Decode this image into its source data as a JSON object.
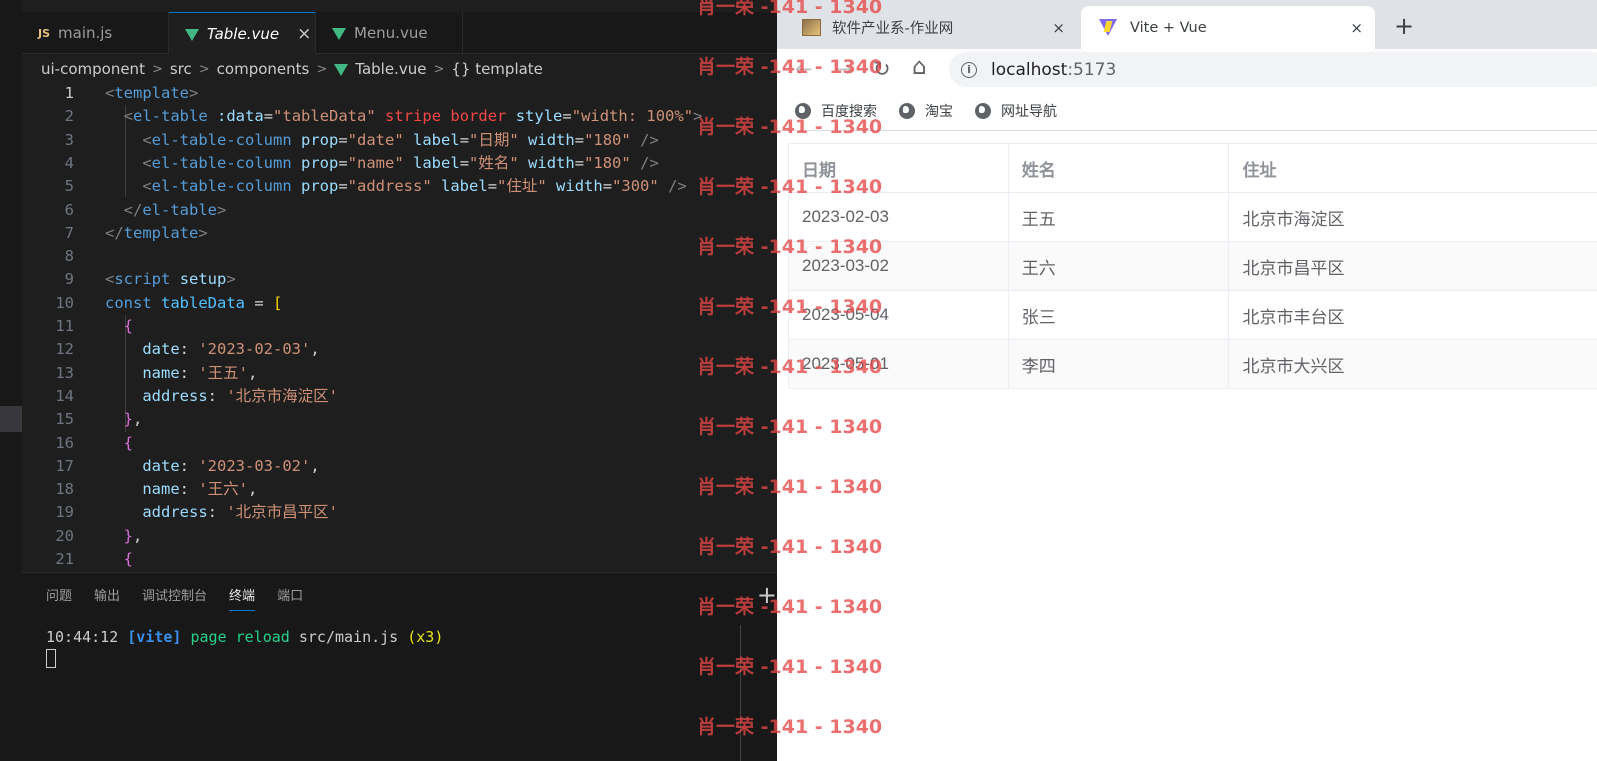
{
  "editor": {
    "tabs": [
      {
        "label": "main.js",
        "type": "js",
        "badge": "JS"
      },
      {
        "label": "Table.vue",
        "type": "vue",
        "active": true,
        "close": "×"
      },
      {
        "label": "Menu.vue",
        "type": "vue"
      }
    ],
    "breadcrumb": [
      "ui-component",
      "src",
      "components",
      "Table.vue",
      "{} template"
    ],
    "lines": [
      {
        "n": "1",
        "code": "<template>"
      },
      {
        "n": "2",
        "code": "  <el-table :data=\"tableData\" stripe border style=\"width: 100%\">"
      },
      {
        "n": "3",
        "code": "    <el-table-column prop=\"date\" label=\"日期\" width=\"180\" />"
      },
      {
        "n": "4",
        "code": "    <el-table-column prop=\"name\" label=\"姓名\" width=\"180\" />"
      },
      {
        "n": "5",
        "code": "    <el-table-column prop=\"address\" label=\"住址\" width=\"300\" />"
      },
      {
        "n": "6",
        "code": "  </el-table>"
      },
      {
        "n": "7",
        "code": "</template>"
      },
      {
        "n": "8",
        "code": ""
      },
      {
        "n": "9",
        "code": "<script setup>"
      },
      {
        "n": "10",
        "code": "const tableData = ["
      },
      {
        "n": "11",
        "code": "  {"
      },
      {
        "n": "12",
        "code": "    date: '2023-02-03',"
      },
      {
        "n": "13",
        "code": "    name: '王五',"
      },
      {
        "n": "14",
        "code": "    address: '北京市海淀区'"
      },
      {
        "n": "15",
        "code": "  },"
      },
      {
        "n": "16",
        "code": "  {"
      },
      {
        "n": "17",
        "code": "    date: '2023-03-02',"
      },
      {
        "n": "18",
        "code": "    name: '王六',"
      },
      {
        "n": "19",
        "code": "    address: '北京市昌平区'"
      },
      {
        "n": "20",
        "code": "  },"
      },
      {
        "n": "21",
        "code": "  {"
      }
    ],
    "panel_tabs": [
      "问题",
      "输出",
      "调试控制台",
      "终端",
      "端口"
    ],
    "active_panel_tab": "终端",
    "panel_plus": "+",
    "terminal": {
      "time": "10:44:12",
      "tag": "[vite]",
      "message": "page reload",
      "file": "src/main.js",
      "count": "(x3)"
    }
  },
  "browser": {
    "tabs": [
      {
        "title": "软件产业系-作业网",
        "close": "×"
      },
      {
        "title": "Vite + Vue",
        "close": "×",
        "active": true
      }
    ],
    "new_tab": "+",
    "nav": {
      "back": "←",
      "forward": "→",
      "reload": "↻",
      "home": "⌂"
    },
    "url_host": "localhost",
    "url_port": ":5173",
    "bookmarks": [
      "百度搜索",
      "淘宝",
      "网址导航"
    ],
    "table": {
      "headers": [
        "日期",
        "姓名",
        "住址"
      ],
      "rows": [
        [
          "2023-02-03",
          "王五",
          "北京市海淀区"
        ],
        [
          "2023-03-02",
          "王六",
          "北京市昌平区"
        ],
        [
          "2023-05-04",
          "张三",
          "北京市丰台区"
        ],
        [
          "2023-05-01",
          "李四",
          "北京市大兴区"
        ]
      ]
    }
  },
  "watermark": {
    "text": "肖一荣 -141 - 1340",
    "count": 13
  }
}
